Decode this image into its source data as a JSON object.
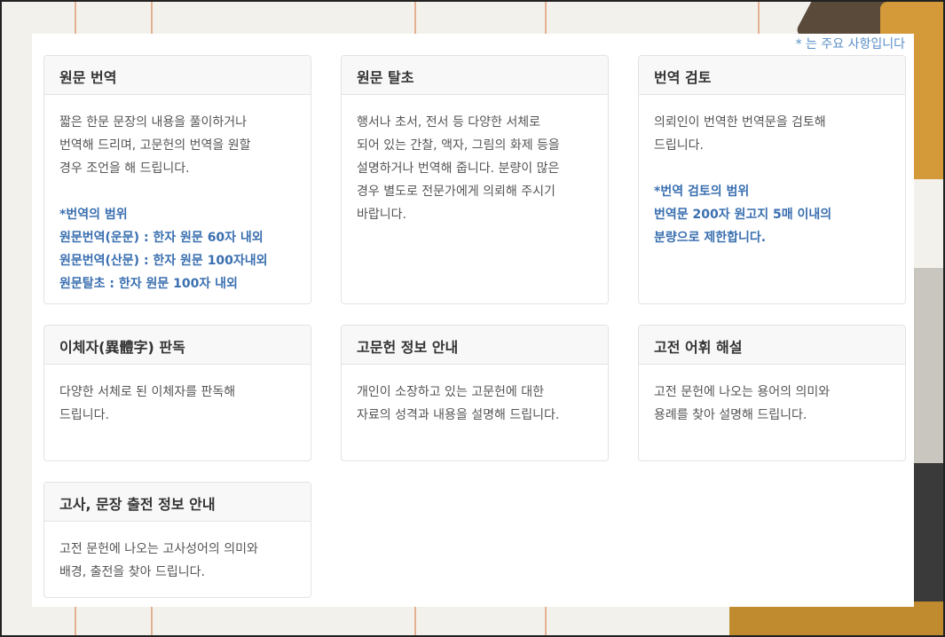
{
  "notice": "* 는 주요 사항입니다",
  "cards": [
    {
      "title": "원문 번역",
      "lines": [
        "짧은 한문 문장의 내용을 풀이하거나",
        "번역해 드리며, 고문헌의 번역을 원할",
        "경우 조언을 해 드립니다."
      ],
      "scope": [
        "*번역의 범위",
        "원문번역(운문) : 한자 원문 60자 내외",
        "원문번역(산문) : 한자 원문 100자내외",
        "원문탈초 : 한자 원문 100자 내외"
      ]
    },
    {
      "title": "원문 탈초",
      "lines": [
        "행서나 초서, 전서 등 다양한 서체로",
        "되어 있는 간찰, 액자, 그림의 화제 등을",
        "설명하거나 번역해 줍니다. 분량이 많은",
        "경우 별도로 전문가에게 의뢰해 주시기",
        "바랍니다."
      ]
    },
    {
      "title": "번역 검토",
      "lines": [
        "의뢰인이 번역한 번역문을 검토해",
        "드립니다."
      ],
      "scope": [
        "*번역 검토의 범위",
        "번역문 200자 원고지 5매 이내의",
        "분량으로 제한합니다."
      ]
    },
    {
      "title": "이체자(異體字) 판독",
      "lines": [
        "다양한 서체로 된 이체자를 판독해",
        "드립니다."
      ]
    },
    {
      "title": "고문헌 정보 안내",
      "lines": [
        "개인이 소장하고 있는 고문헌에 대한",
        "자료의 성격과 내용을 설명해 드립니다."
      ]
    },
    {
      "title": "고전 어휘 해설",
      "lines": [
        "고전 문헌에 나오는 용어의 의미와",
        "용례를 찾아 설명해 드립니다."
      ]
    },
    {
      "title": "고사, 문장 출전 정보 안내",
      "lines": [
        "고전 문헌에 나오는 고사성어의 의미와",
        "배경, 출전을 찾아 드립니다."
      ]
    }
  ]
}
